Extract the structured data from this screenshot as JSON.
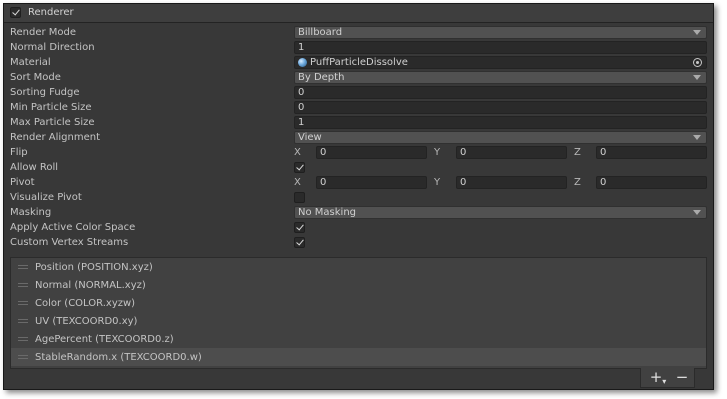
{
  "header": {
    "title": "Renderer",
    "enabled": true
  },
  "fields": {
    "render_mode": {
      "label": "Render Mode",
      "value": "Billboard"
    },
    "normal_direction": {
      "label": "Normal Direction",
      "value": "1"
    },
    "material": {
      "label": "Material",
      "value": "PuffParticleDissolve"
    },
    "sort_mode": {
      "label": "Sort Mode",
      "value": "By Depth"
    },
    "sorting_fudge": {
      "label": "Sorting Fudge",
      "value": "0"
    },
    "min_particle_size": {
      "label": "Min Particle Size",
      "value": "0"
    },
    "max_particle_size": {
      "label": "Max Particle Size",
      "value": "1"
    },
    "render_alignment": {
      "label": "Render Alignment",
      "value": "View"
    },
    "flip": {
      "label": "Flip",
      "x_label": "X",
      "y_label": "Y",
      "z_label": "Z",
      "x": "0",
      "y": "0",
      "z": "0"
    },
    "allow_roll": {
      "label": "Allow Roll",
      "checked": true
    },
    "pivot": {
      "label": "Pivot",
      "x_label": "X",
      "y_label": "Y",
      "z_label": "Z",
      "x": "0",
      "y": "0",
      "z": "0"
    },
    "visualize_pivot": {
      "label": "Visualize Pivot",
      "checked": false
    },
    "masking": {
      "label": "Masking",
      "value": "No Masking"
    },
    "apply_active_color_space": {
      "label": "Apply Active Color Space",
      "checked": true
    },
    "custom_vertex_streams": {
      "label": "Custom Vertex Streams",
      "checked": true
    }
  },
  "streams": [
    "Position (POSITION.xyz)",
    "Normal (NORMAL.xyz)",
    "Color (COLOR.xyzw)",
    "UV (TEXCOORD0.xy)",
    "AgePercent (TEXCOORD0.z)",
    "StableRandom.x (TEXCOORD0.w)"
  ],
  "selected_stream_index": 5,
  "footer": {
    "add": "+",
    "remove": "−"
  },
  "colors": {
    "panel": "#383838",
    "field": "#2a2a2a",
    "dropdown": "#515151",
    "text": "#c4c4c4"
  }
}
